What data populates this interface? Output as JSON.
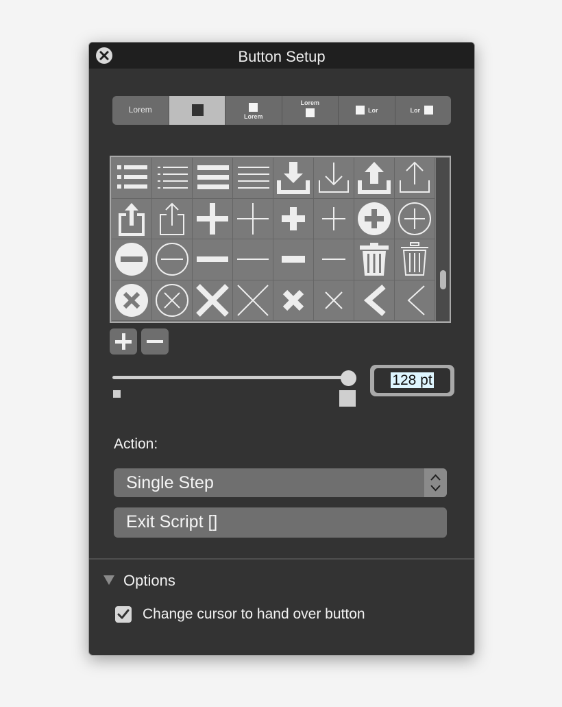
{
  "window": {
    "title": "Button Setup"
  },
  "style_tabs": [
    {
      "label": "Lorem",
      "icon": "text-only-icon"
    },
    {
      "label": "",
      "icon": "icon-only-icon",
      "selected": true
    },
    {
      "label": "Lorem",
      "icon": "icon-above-text-icon"
    },
    {
      "label": "Lorem",
      "icon": "text-above-icon-icon"
    },
    {
      "label": "Lor",
      "icon": "icon-left-of-text-icon"
    },
    {
      "label": "Lor",
      "icon": "text-left-of-icon-icon"
    }
  ],
  "icon_grid": {
    "rows": [
      [
        "list-bold-icon",
        "list-thin-icon",
        "menu-bold-icon",
        "menu-thin-icon",
        "download-bold-icon",
        "download-thin-icon",
        "upload-bold-icon",
        "upload-thin-icon"
      ],
      [
        "share-bold-icon",
        "share-thin-icon",
        "plus-bold-icon",
        "plus-thin-icon",
        "plus-medium-icon",
        "plus-small-icon",
        "plus-circle-filled-icon",
        "plus-circle-outline-icon"
      ],
      [
        "minus-circle-filled-icon",
        "minus-circle-outline-icon",
        "minus-bold-icon",
        "minus-thin-icon",
        "minus-medium-icon",
        "minus-small-icon",
        "trash-bold-icon",
        "trash-thin-icon"
      ],
      [
        "x-circle-filled-icon",
        "x-circle-outline-icon",
        "x-bold-icon",
        "x-thin-icon",
        "x-medium-icon",
        "x-small-icon",
        "chevron-left-bold-icon",
        "chevron-left-thin-icon"
      ]
    ]
  },
  "icon_buttons": {
    "add": "plus-icon",
    "remove": "minus-icon"
  },
  "size": {
    "value_label": "128 pt",
    "fraction": 1.0
  },
  "action": {
    "label": "Action:",
    "selected": "Single Step",
    "script": "Exit Script []"
  },
  "options": {
    "label": "Options",
    "hand_cursor": {
      "label": "Change cursor to hand over button",
      "checked": true
    }
  },
  "colors": {
    "window_bg": "#333333",
    "titlebar": "#1f1f1f",
    "control": "#6f6f6f",
    "selected_segment": "#bdbdbd"
  }
}
